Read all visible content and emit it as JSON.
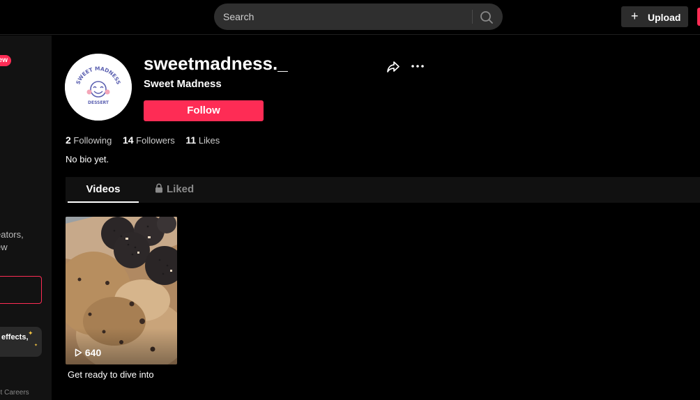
{
  "search": {
    "placeholder": "Search"
  },
  "header": {
    "upload_label": "Upload"
  },
  "sidebar": {
    "new_badge": "ew",
    "promo_line1": "eators,",
    "promo_line2": "ew",
    "effects_label": "effects,",
    "footer_links": "act  Careers"
  },
  "profile": {
    "username": "sweetmadness._",
    "display_name": "Sweet Madness",
    "follow_label": "Follow",
    "following_count": "2",
    "following_label": "Following",
    "followers_count": "14",
    "followers_label": "Followers",
    "likes_count": "11",
    "likes_label": "Likes",
    "bio": "No bio yet.",
    "avatar_logo_text": "SWEET MADNESS DESSERT"
  },
  "tabs": {
    "videos": "Videos",
    "liked": "Liked"
  },
  "videos": [
    {
      "views": "640",
      "caption": "Get ready to dive into"
    }
  ],
  "colors": {
    "accent": "#fe2c55",
    "background": "#000000",
    "sidebar": "#121212",
    "avatar_logo": "#5a5fb0"
  },
  "icons": {
    "search": "search-icon",
    "upload": "plus-icon",
    "share": "share-icon",
    "more": "more-icon",
    "lock": "lock-icon",
    "play": "play-icon"
  }
}
